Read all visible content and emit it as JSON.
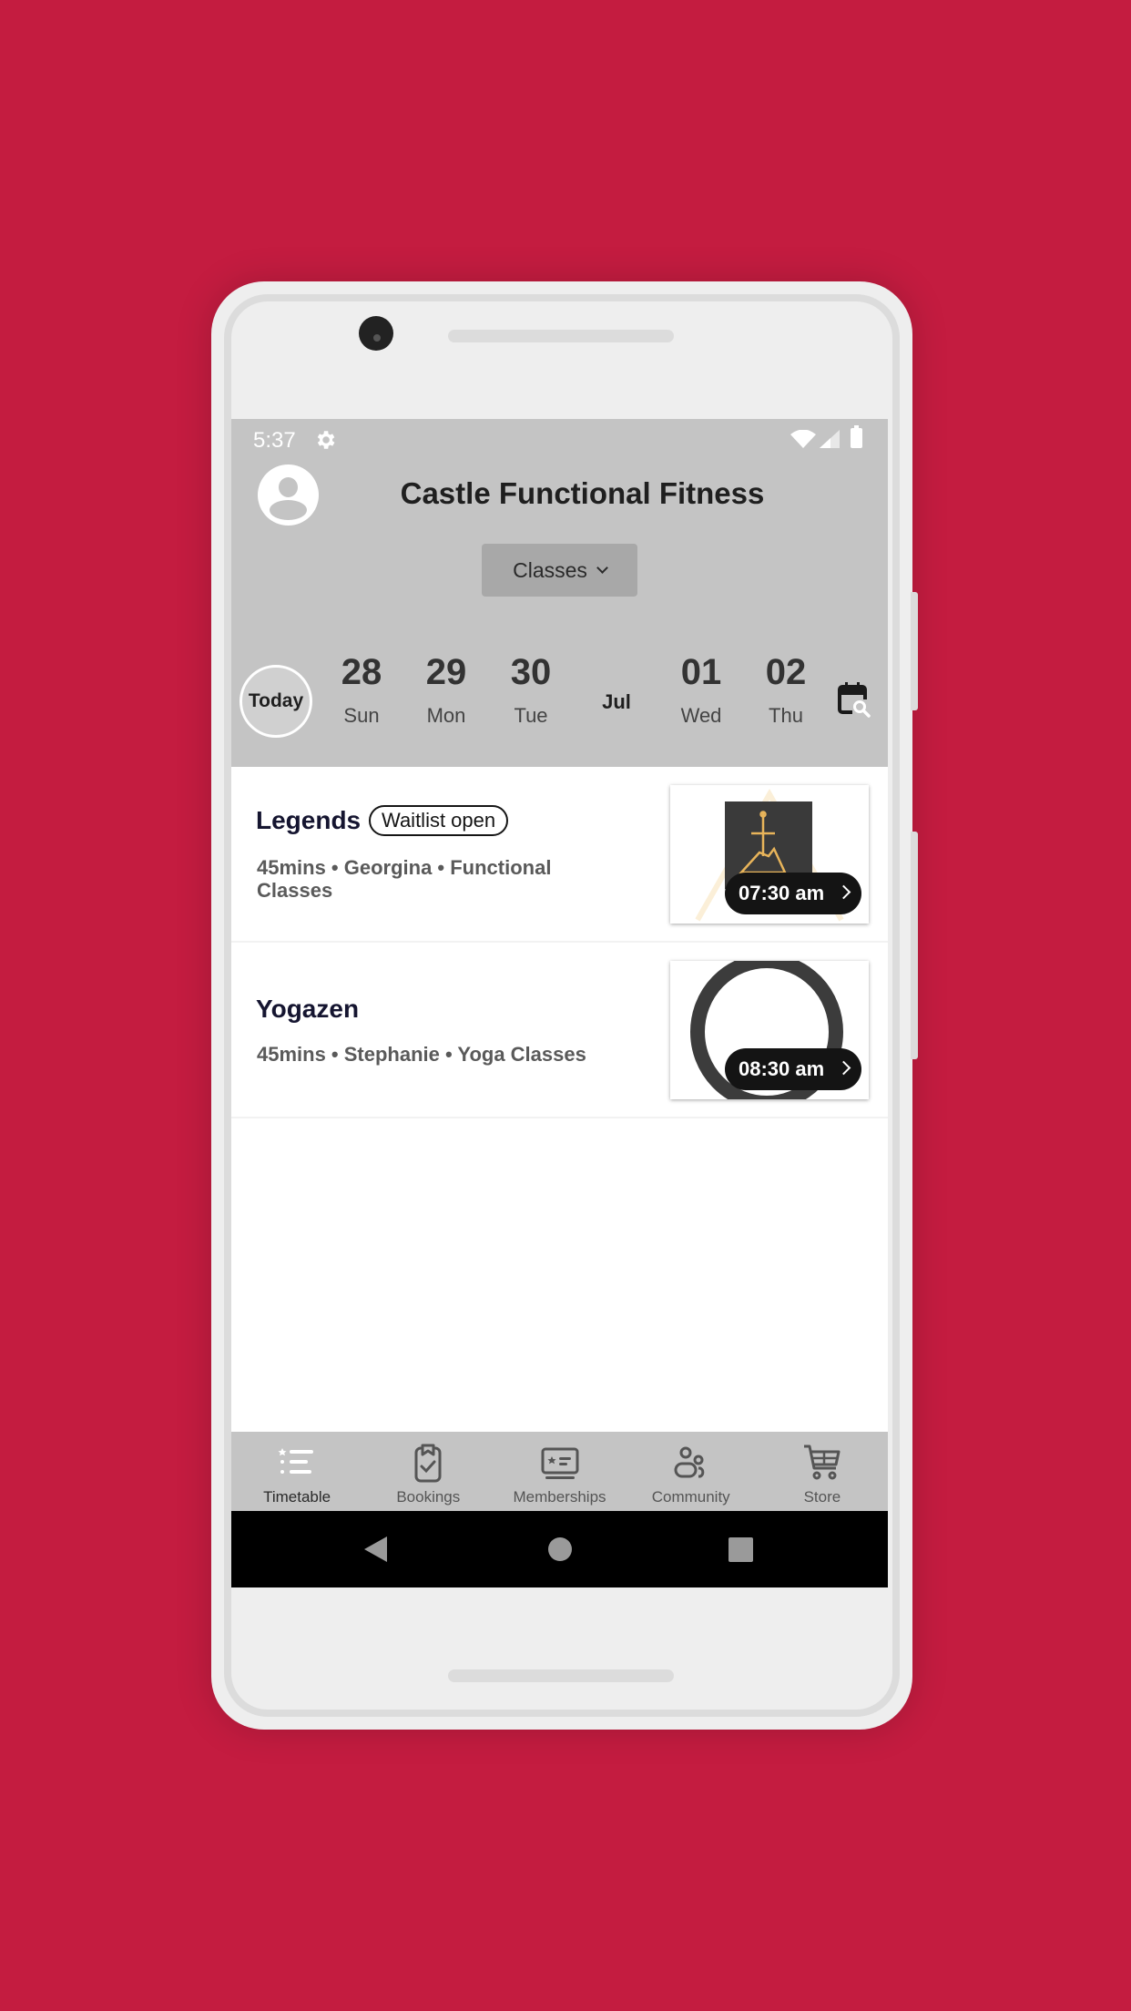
{
  "status_bar": {
    "time": "5:37",
    "icons": [
      "gear-icon",
      "wifi-icon",
      "signal-icon",
      "battery-icon"
    ]
  },
  "header": {
    "title": "Castle Functional Fitness",
    "dropdown": {
      "selected": "Classes",
      "icon": "chevron-down-icon"
    }
  },
  "date_strip": {
    "today_label": "Today",
    "days": [
      {
        "num": "28",
        "dow": "Sun"
      },
      {
        "num": "29",
        "dow": "Mon"
      },
      {
        "num": "30",
        "dow": "Tue"
      },
      {
        "num": "01",
        "dow": "Wed"
      },
      {
        "num": "02",
        "dow": "Thu"
      }
    ],
    "month_label": "Jul",
    "calendar_search_icon": "calendar-search-icon"
  },
  "classes": [
    {
      "name": "Legends",
      "badge": "Waitlist open",
      "meta": "45mins • Georgina • Functional Classes",
      "time": "07:30 am",
      "thumbnail": "sword-mountain-logo"
    },
    {
      "name": "Yogazen",
      "badge": "",
      "meta": "45mins • Stephanie • Yoga Classes",
      "time": "08:30 am",
      "thumbnail": "enso-circle"
    }
  ],
  "bottom_nav": {
    "active": "Timetable",
    "items": [
      {
        "label": "Timetable",
        "icon": "timetable-list-icon"
      },
      {
        "label": "Bookings",
        "icon": "clipboard-check-icon"
      },
      {
        "label": "Memberships",
        "icon": "membership-card-icon"
      },
      {
        "label": "Community",
        "icon": "community-people-icon"
      },
      {
        "label": "Store",
        "icon": "cart-icon"
      }
    ]
  },
  "colors": {
    "background": "#c41c40",
    "header_gray": "#c4c4c4",
    "accent_gold": "#e8b45a",
    "pill_black": "#141414"
  }
}
